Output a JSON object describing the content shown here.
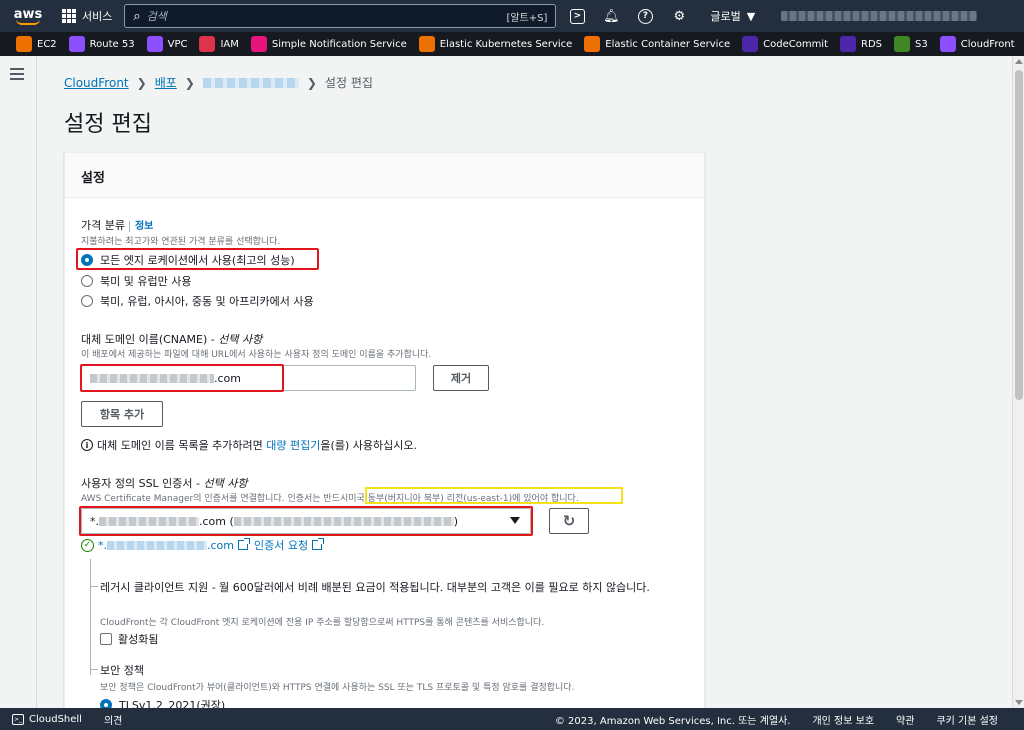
{
  "topnav": {
    "logo": "aws",
    "services": "서비스",
    "search_placeholder": "검색",
    "search_hint": "[알트+S]",
    "region": "글로벌"
  },
  "favorites": [
    {
      "label": "EC2",
      "color": "#ed7100"
    },
    {
      "label": "Route 53",
      "color": "#8c4fff"
    },
    {
      "label": "VPC",
      "color": "#8c4fff"
    },
    {
      "label": "IAM",
      "color": "#dd344c"
    },
    {
      "label": "Simple Notification Service",
      "color": "#e7157b"
    },
    {
      "label": "Elastic Kubernetes Service",
      "color": "#ed7100"
    },
    {
      "label": "Elastic Container Service",
      "color": "#ed7100"
    },
    {
      "label": "CodeCommit",
      "color": "#4d27aa"
    },
    {
      "label": "RDS",
      "color": "#4d27aa"
    },
    {
      "label": "S3",
      "color": "#3f8624"
    },
    {
      "label": "CloudFront",
      "color": "#8c4fff"
    }
  ],
  "breadcrumb": {
    "root": "CloudFront",
    "second": "배포",
    "current": "설정 편집"
  },
  "page_title": "설정 편집",
  "panel_title": "설정",
  "price": {
    "label": "가격 분류",
    "info": "정보",
    "desc": "지불하려는 최고가와 연관된 가격 분류를 선택합니다.",
    "options": [
      "모든 엣지 로케이션에서 사용(최고의 성능)",
      "북미 및 유럽만 사용",
      "북미, 유럽, 아시아, 중동 및 아프리카에서 사용"
    ]
  },
  "cname": {
    "label": "대체 도메인 이름(CNAME) -",
    "optional": "선택 사항",
    "desc": "이 배포에서 제공하는 파일에 대해 URL에서 사용하는 사용자 정의 도메인 이름을 추가합니다.",
    "value_suffix": ".com",
    "remove": "제거",
    "add": "항목 추가",
    "note_before": "대체 도메인 이름 목록을 추가하려면",
    "note_link": "대량 편집기",
    "note_after": "을(를) 사용하십시오."
  },
  "ssl": {
    "label": "사용자 정의 SSL 인증서 -",
    "optional": "선택 사항",
    "desc_before": "AWS Certificate Manager의 인증서를 연결합니다. 인증서는 반드시",
    "desc_highlight": "미국 동부(버지니아 북부) 리전(us-east-1)",
    "desc_after": "에 있어야 합니다.",
    "select_prefix": "*.",
    "select_mid": ".com (",
    "select_end": ")",
    "status_prefix": "*.",
    "status_suffix": ".com",
    "request": "인증서 요청"
  },
  "legacy": {
    "title": "레거시 클라이언트 지원 - 월 600달러에서 비례 배분된 요금이 적용됩니다. 대부분의 고객은 이를 필요로 하지 않습니다.",
    "desc": "CloudFront는 각 CloudFront 엣지 로케이션에 전용 IP 주소를 할당함으로써 HTTPS를 통해 콘텐츠를 서비스합니다.",
    "checkbox": "활성화됨"
  },
  "security": {
    "title": "보안 정책",
    "desc": "보안 정책은 CloudFront가 뷰어(클라이언트)와 HTTPS 연결에 사용하는 SSL 또는 TLS 프로토콜 및 특정 암호를 결정합니다.",
    "option": "TLSv1.2_2021(권장)"
  },
  "footer": {
    "cloudshell": "CloudShell",
    "feedback": "의견",
    "copyright": "© 2023, Amazon Web Services, Inc. 또는 계열사.",
    "privacy": "개인 정보 보호",
    "terms": "약관",
    "cookies": "쿠키 기본 설정"
  }
}
